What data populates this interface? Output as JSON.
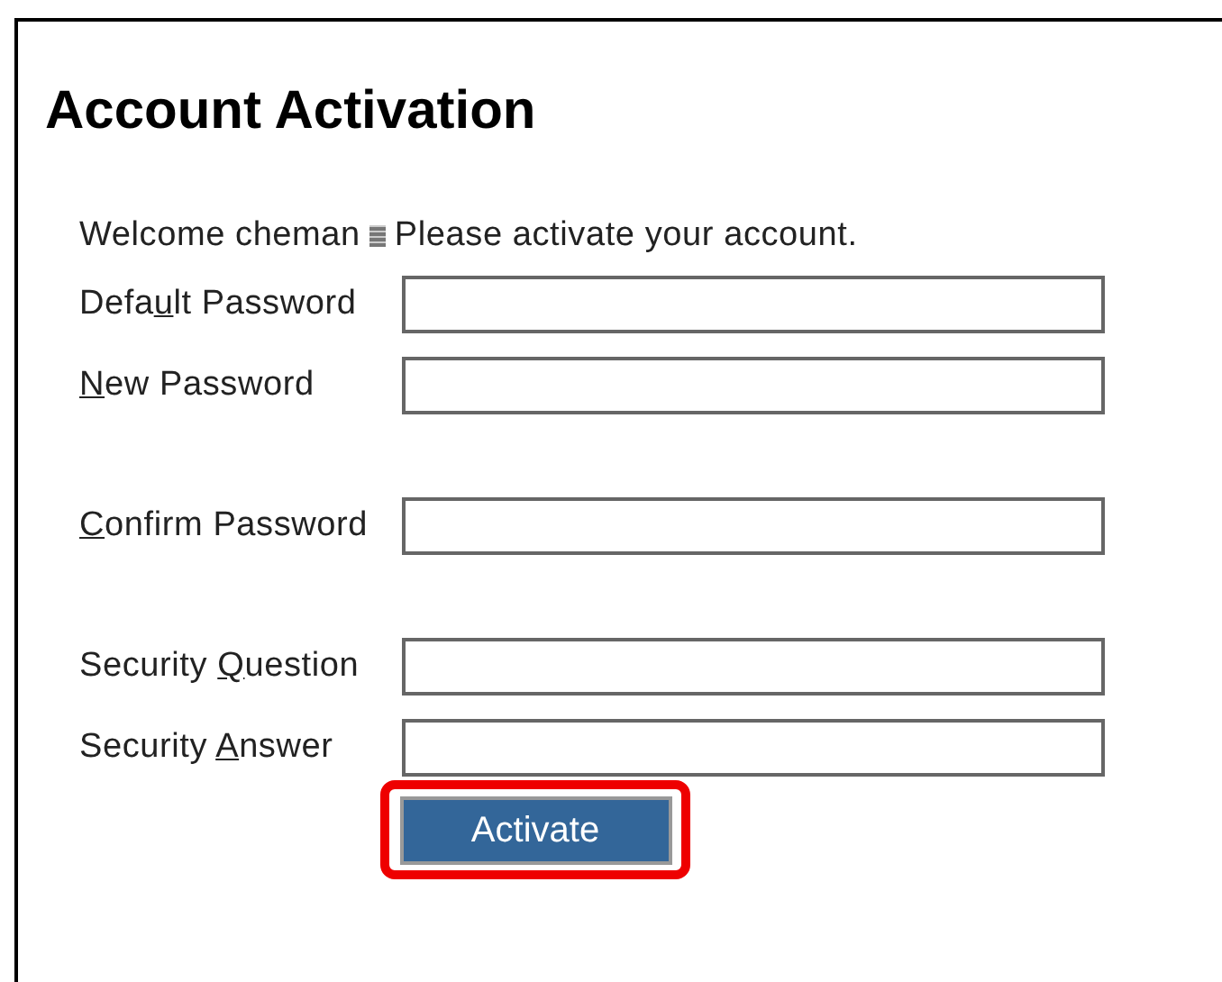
{
  "title": "Account Activation",
  "welcome": {
    "before": "Welcome cheman",
    "after": "Please activate your account."
  },
  "fields": [
    {
      "label_parts": [
        {
          "text": "Defa",
          "underlined": false
        },
        {
          "text": "u",
          "underlined": true
        },
        {
          "text": "lt Password",
          "underlined": false
        }
      ]
    },
    {
      "label_parts": [
        {
          "text": "N",
          "underlined": true
        },
        {
          "text": "ew Password",
          "underlined": false
        }
      ]
    },
    {
      "label_parts": [
        {
          "text": "C",
          "underlined": true
        },
        {
          "text": "onfirm Password",
          "underlined": false
        }
      ]
    },
    {
      "label_parts": [
        {
          "text": "Security ",
          "underlined": false
        },
        {
          "text": "Q",
          "underlined": true
        },
        {
          "text": "uestion",
          "underlined": false
        }
      ]
    },
    {
      "label_parts": [
        {
          "text": "Security ",
          "underlined": false
        },
        {
          "text": "A",
          "underlined": true
        },
        {
          "text": "nswer",
          "underlined": false
        }
      ]
    }
  ],
  "button": {
    "label": "Activate",
    "highlighted": true
  }
}
